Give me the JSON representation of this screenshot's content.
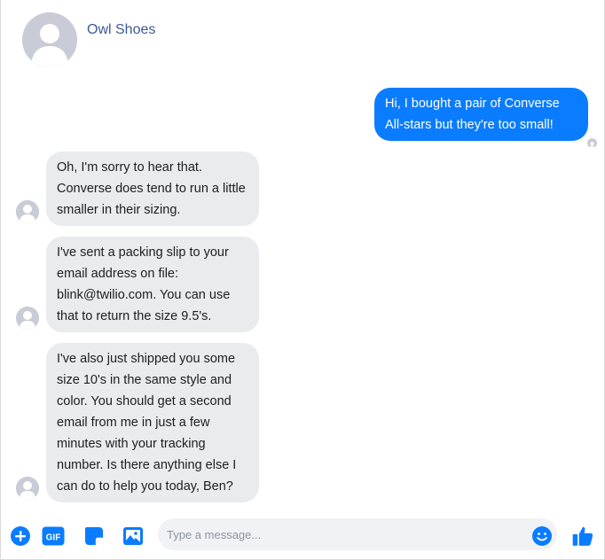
{
  "contact": {
    "name": "Owl Shoes"
  },
  "messages": [
    {
      "from": "user",
      "text": "Hi, I bought a pair of Converse All-stars but they're too small!"
    },
    {
      "from": "agent",
      "text": "Oh, I'm sorry to hear that. Converse does tend to run a little smaller in their sizing."
    },
    {
      "from": "agent",
      "text": "I've sent a packing slip to your email address on file: blink@twilio.com.  You can use that to return the size 9.5's."
    },
    {
      "from": "agent",
      "text": "I've also just shipped you some size 10's in the same style and color.  You should get a second email from me in just a few minutes with your tracking number.  Is there anything else I can do to help you today, Ben?"
    }
  ],
  "composer": {
    "placeholder": "Type a message...",
    "gif_label": "GIF",
    "icons": [
      "plus-circle-icon",
      "gif-icon",
      "sticker-icon",
      "image-icon",
      "emoji-icon",
      "thumbs-up-icon"
    ]
  },
  "colors": {
    "accent": "#0a7cff",
    "incoming_bubble": "#e9ebee",
    "name": "#3b5998",
    "avatar_placeholder": "#c9ccd6"
  }
}
